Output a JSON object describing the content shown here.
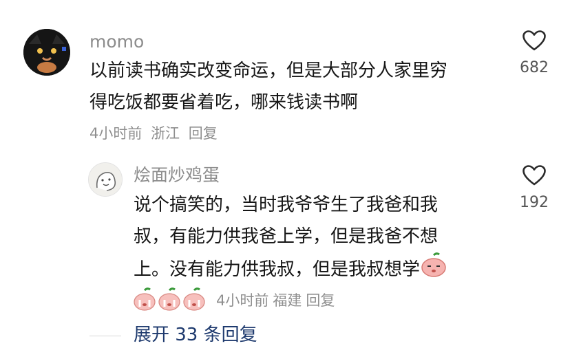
{
  "comment": {
    "username": "momo",
    "lines": [
      "以前读书确实改变命运，但是大部分人家里穷",
      "得吃饭都要省着吃，哪来钱读书啊"
    ],
    "time": "4小时前",
    "location": "浙江",
    "reply_label": "回复",
    "like_count": "682"
  },
  "reply": {
    "username": "烩面炒鸡蛋",
    "lines": [
      "说个搞笑的，当时我爷爷生了我爸和我",
      "叔，有能力供我爸上学，但是我爸不想",
      "上。没有能力供我叔，但是我叔想学"
    ],
    "time": "4小时前",
    "location": "福建",
    "reply_label": "回复",
    "like_count": "192",
    "emoji_name": "peach-face-emoji",
    "sticker_name": "crying-peach-emoji"
  },
  "expand": {
    "label": "展开 33 条回复"
  },
  "colors": {
    "text_primary": "#161616",
    "text_secondary": "#8f8f8f",
    "link": "#1e3a6e",
    "emoji_pink": "#f4a3a3",
    "leaf_green": "#3a9a3a"
  }
}
